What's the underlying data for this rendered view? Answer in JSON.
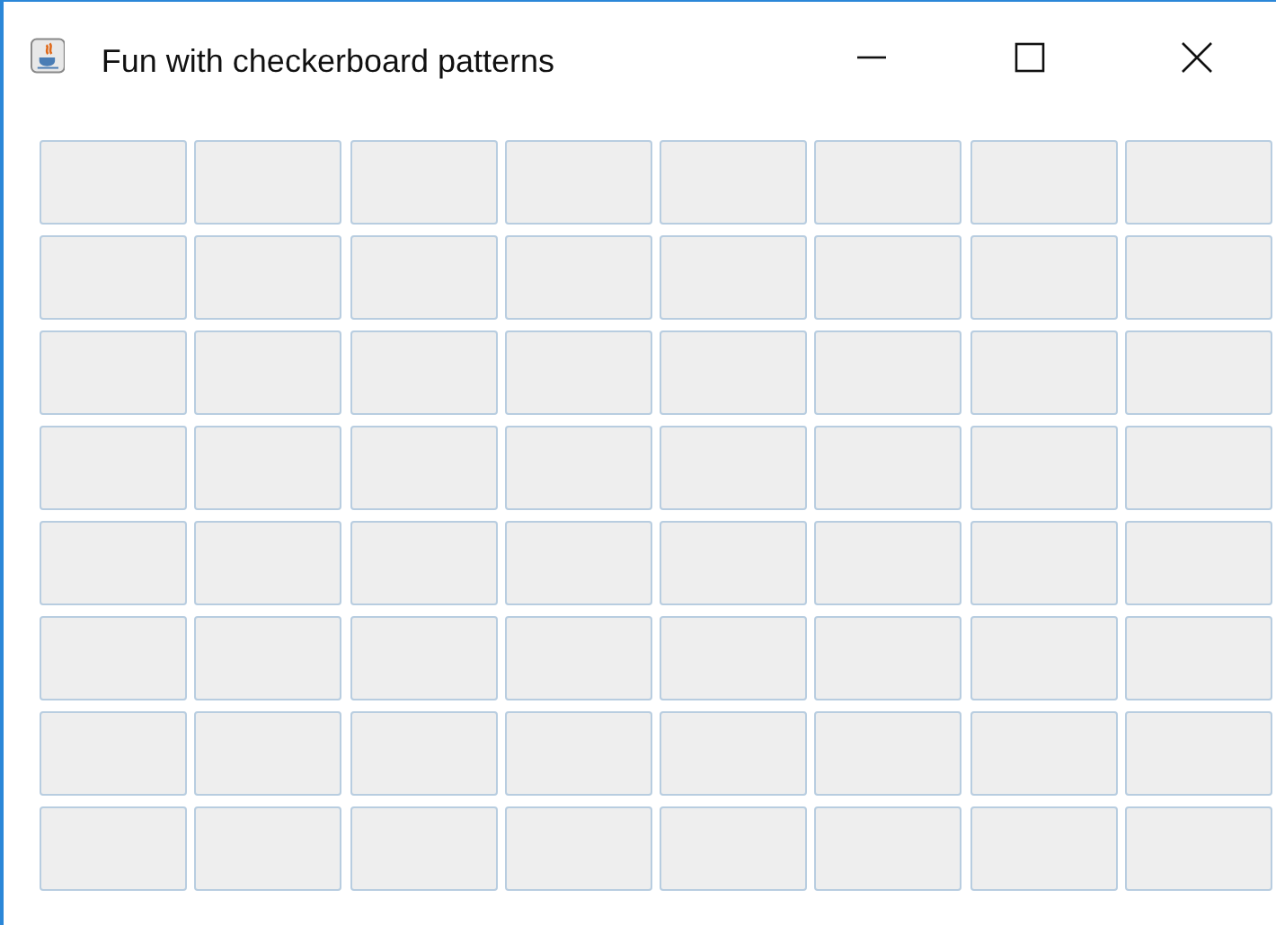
{
  "window": {
    "title": "Fun with checkerboard patterns"
  },
  "board": {
    "rows": [
      [
        {
          "kind": "button"
        },
        {
          "kind": "button"
        },
        {
          "kind": "button"
        },
        {
          "kind": "button"
        },
        {
          "kind": "button"
        },
        {
          "kind": "button"
        },
        {
          "kind": "button"
        },
        {
          "kind": "button"
        }
      ],
      [
        {
          "kind": "button"
        },
        {
          "kind": "button"
        },
        {
          "kind": "button"
        },
        {
          "kind": "button"
        },
        {
          "kind": "button"
        },
        {
          "kind": "button"
        },
        {
          "kind": "button"
        },
        {
          "kind": "button"
        }
      ],
      [
        {
          "kind": "button"
        },
        {
          "kind": "button"
        },
        {
          "kind": "button"
        },
        {
          "kind": "button"
        },
        {
          "kind": "button"
        },
        {
          "kind": "button"
        },
        {
          "kind": "button"
        },
        {
          "kind": "button"
        }
      ],
      [
        {
          "kind": "button"
        },
        {
          "kind": "button"
        },
        {
          "kind": "button"
        },
        {
          "kind": "button"
        },
        {
          "kind": "button"
        },
        {
          "kind": "button"
        },
        {
          "kind": "button"
        },
        {
          "kind": "button"
        }
      ],
      [
        {
          "kind": "button"
        },
        {
          "kind": "button"
        },
        {
          "kind": "button"
        },
        {
          "kind": "button"
        },
        {
          "kind": "button"
        },
        {
          "kind": "button"
        },
        {
          "kind": "button"
        },
        {
          "kind": "button"
        }
      ],
      [
        {
          "kind": "button"
        },
        {
          "kind": "button"
        },
        {
          "kind": "button"
        },
        {
          "kind": "button"
        },
        {
          "kind": "button"
        },
        {
          "kind": "button"
        },
        {
          "kind": "button"
        },
        {
          "kind": "button"
        }
      ],
      [
        {
          "kind": "button"
        },
        {
          "kind": "button"
        },
        {
          "kind": "button"
        },
        {
          "kind": "button"
        },
        {
          "kind": "button"
        },
        {
          "kind": "button"
        },
        {
          "kind": "button"
        },
        {
          "kind": "button"
        }
      ],
      [
        {
          "kind": "button"
        },
        {
          "kind": "button"
        },
        {
          "kind": "button"
        },
        {
          "kind": "button"
        },
        {
          "kind": "button"
        },
        {
          "kind": "button"
        },
        {
          "kind": "button"
        },
        {
          "kind": "button"
        }
      ]
    ]
  }
}
